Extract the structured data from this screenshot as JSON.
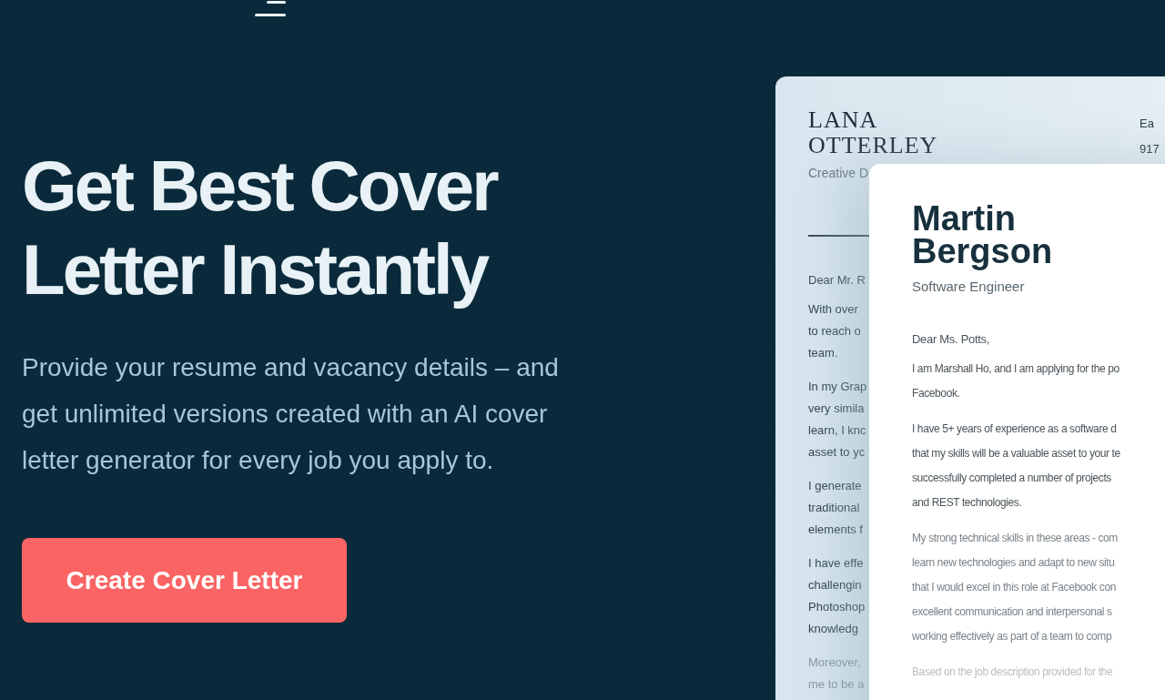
{
  "hero": {
    "title_lines": [
      "Get Best Cover",
      "Letter Instantly"
    ],
    "description": "Provide your resume and vacancy details – and get unlimited versions created with an AI cover letter generator for every job you apply to.",
    "button": "Create Cover Letter"
  },
  "back_letter": {
    "name_lines": [
      "LANA",
      "OTTERLEY"
    ],
    "role": "Creative D",
    "contact": [
      "Ea",
      "917"
    ],
    "greeting": "Dear Mr. R",
    "paragraphs": [
      [
        "With over",
        "to reach o",
        "team."
      ],
      [
        "In my Grap",
        "very simila",
        "learn, I knc",
        "asset to yc"
      ],
      [
        "I generate",
        "traditional",
        "elements f"
      ],
      [
        "I have effe",
        "challengin",
        "Photoshop",
        "knowledg"
      ],
      [
        "Moreover,",
        "me to be a"
      ]
    ]
  },
  "front_letter": {
    "name_lines": [
      "Martin",
      "Bergson"
    ],
    "role": "Software Engineer",
    "greeting": "Dear Ms. Potts,",
    "paragraphs": [
      [
        "I am Marshall Ho, and I am applying for the po",
        "Facebook."
      ],
      [
        "I have 5+ years of experience as a software d",
        "that my skills will be a valuable asset to your te",
        "successfully completed a number of projects",
        "and REST technologies."
      ],
      [
        "My strong technical skills in these areas - com",
        "learn new technologies and adapt to new situ",
        "that I would excel in this role at Facebook con",
        "excellent communication and interpersonal s",
        "working effectively as part of a team to comp"
      ],
      [
        "Based on the job description provided for the"
      ]
    ]
  }
}
